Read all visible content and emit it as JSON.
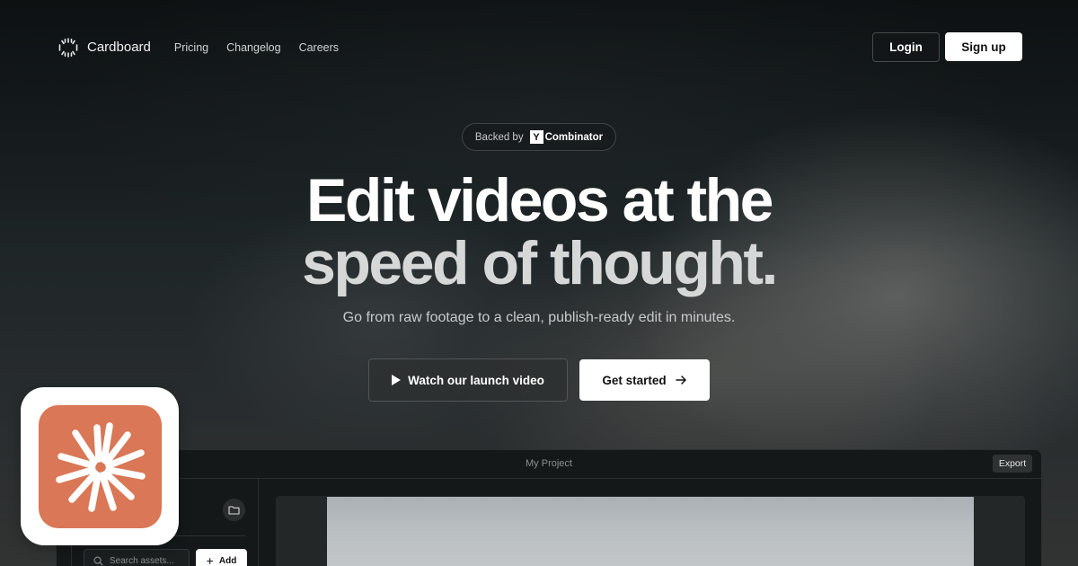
{
  "nav": {
    "brand_name": "Cardboard",
    "brand_icon": "dashed-circle-icon",
    "links": [
      {
        "label": "Pricing"
      },
      {
        "label": "Changelog"
      },
      {
        "label": "Careers"
      }
    ],
    "login_label": "Login",
    "signup_label": "Sign up"
  },
  "badge": {
    "prefix": "Backed by",
    "logo_letter": "Y",
    "brand": "Combinator"
  },
  "hero": {
    "title_line1": "Edit videos at the",
    "title_line2": "speed of thought.",
    "subtitle": "Go from raw footage to a clean, publish-ready edit in minutes."
  },
  "cta": {
    "watch_label": "Watch our launch video",
    "start_label": "Get started"
  },
  "editor": {
    "project_title": "My Project",
    "export_label": "Export",
    "search_placeholder": "Search assets...",
    "add_label": "Add"
  },
  "colors": {
    "accent_orange": "#d97756",
    "background": "#1c2224",
    "button_light": "#ffffff"
  }
}
